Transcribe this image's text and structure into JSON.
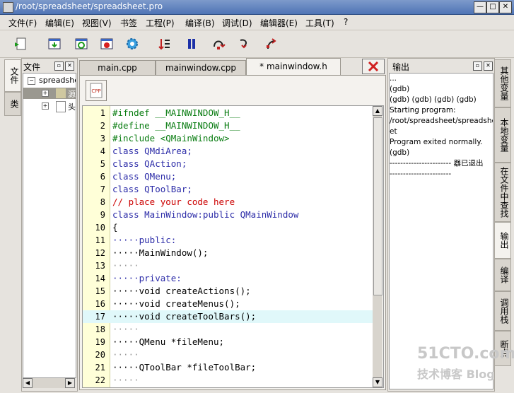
{
  "window": {
    "title": "/root/spreadsheet/spreadsheet.pro"
  },
  "menu": [
    "文件(F)",
    "编辑(E)",
    "视图(V)",
    "书签",
    "工程(P)",
    "编译(B)",
    "调试(D)",
    "编辑器(E)",
    "工具(T)",
    "?"
  ],
  "left_tabs": [
    "文件",
    "类"
  ],
  "file_panel": {
    "title": "文件",
    "tree": [
      "spreadsheet",
      "源",
      "头"
    ]
  },
  "editor": {
    "tabs": [
      "main.cpp",
      "mainwindow.cpp",
      "* mainwindow.h"
    ],
    "active_tab": 2,
    "cpp_button": "CPP",
    "lines": [
      {
        "n": "1",
        "t": "#ifndef __MAINWINDOW_H__",
        "c": "pre"
      },
      {
        "n": "2",
        "t": "#define __MAINWINDOW_H__",
        "c": "pre"
      },
      {
        "n": "3",
        "t": "#include <QMainWindow>",
        "c": "pre"
      },
      {
        "n": "4",
        "t": "class QMdiArea;",
        "c": "cls"
      },
      {
        "n": "5",
        "t": "class QAction;",
        "c": "cls"
      },
      {
        "n": "6",
        "t": "class QMenu;",
        "c": "cls"
      },
      {
        "n": "7",
        "t": "class QToolBar;",
        "c": "cls"
      },
      {
        "n": "8",
        "t": "// place your code here",
        "c": "cmt"
      },
      {
        "n": "9",
        "t": "class MainWindow:public QMainWindow",
        "c": "cls"
      },
      {
        "n": "10",
        "t": "{",
        "c": "plain"
      },
      {
        "n": "11",
        "t": "·····public:",
        "c": "kw"
      },
      {
        "n": "12",
        "t": "·····MainWindow();",
        "c": "plain"
      },
      {
        "n": "13",
        "t": "·····",
        "c": "dots"
      },
      {
        "n": "14",
        "t": "·····private:",
        "c": "kw"
      },
      {
        "n": "15",
        "t": "·····void createActions();",
        "c": "fn"
      },
      {
        "n": "16",
        "t": "·····void createMenus();",
        "c": "fn"
      },
      {
        "n": "17",
        "t": "·····void createToolBars();",
        "c": "fn"
      },
      {
        "n": "18",
        "t": "·····",
        "c": "dots"
      },
      {
        "n": "19",
        "t": "·····QMenu *fileMenu;",
        "c": "mem"
      },
      {
        "n": "20",
        "t": "·····",
        "c": "dots"
      },
      {
        "n": "21",
        "t": "·····QToolBar *fileToolBar;",
        "c": "mem"
      },
      {
        "n": "22",
        "t": "·····",
        "c": "dots"
      }
    ],
    "current_line": 17
  },
  "output_panel": {
    "title": "输出",
    "lines": [
      "   ...",
      "(gdb)",
      "(gdb) (gdb) (gdb) (gdb)",
      "Starting program:",
      "/root/spreadsheet/spreadshe",
      "et",
      "Program exited normally.",
      "(gdb)",
      "-----------------------     器已退出",
      "-----------------------"
    ]
  },
  "right_tabs": [
    "其他变量",
    "本地变量",
    "在文件中查找",
    "输出",
    "编译",
    "调用栈",
    "断点"
  ],
  "watermark": {
    "line1": "51CTO.com",
    "line2": "技术博客  Blog"
  },
  "colors": {
    "preprocessor": "#0a7d12",
    "keyword": "#2c2ca8",
    "comment": "#cc0000",
    "class": "#2c2ca8",
    "accent": "#4f74b5"
  }
}
